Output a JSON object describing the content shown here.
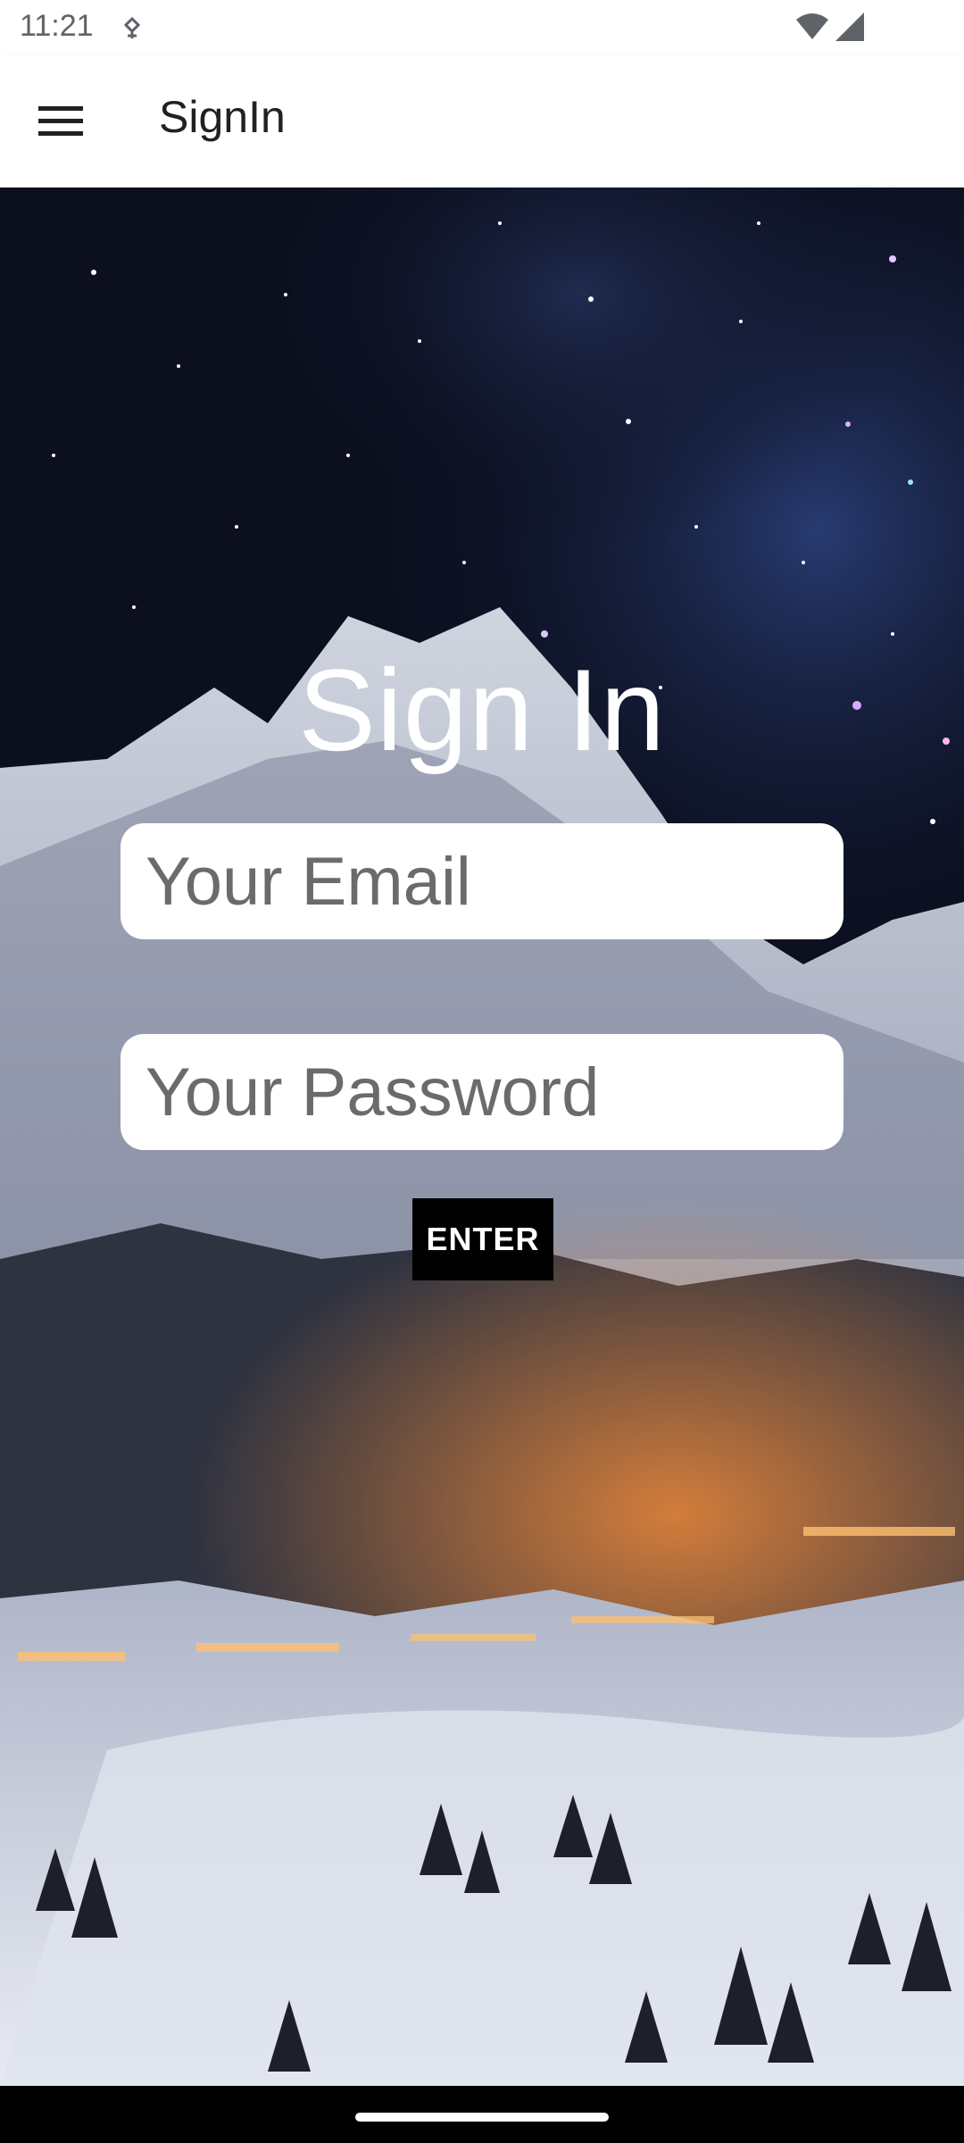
{
  "status_bar": {
    "time": "11:21",
    "icons": [
      "sync-icon",
      "wifi-icon",
      "signal-icon"
    ]
  },
  "app_bar": {
    "title": "SignIn",
    "menu_icon": "menu-icon"
  },
  "form": {
    "heading": "Sign In",
    "email_placeholder": "Your Email",
    "email_value": "",
    "password_placeholder": "Your Password",
    "password_value": "",
    "enter_label": "ENTER"
  },
  "colors": {
    "app_bar_bg": "#ffffff",
    "button_bg": "#000000",
    "button_text": "#ffffff",
    "heading_text": "#ffffff",
    "sky": "#0b0f1e",
    "snow": "#e6e9f0"
  }
}
